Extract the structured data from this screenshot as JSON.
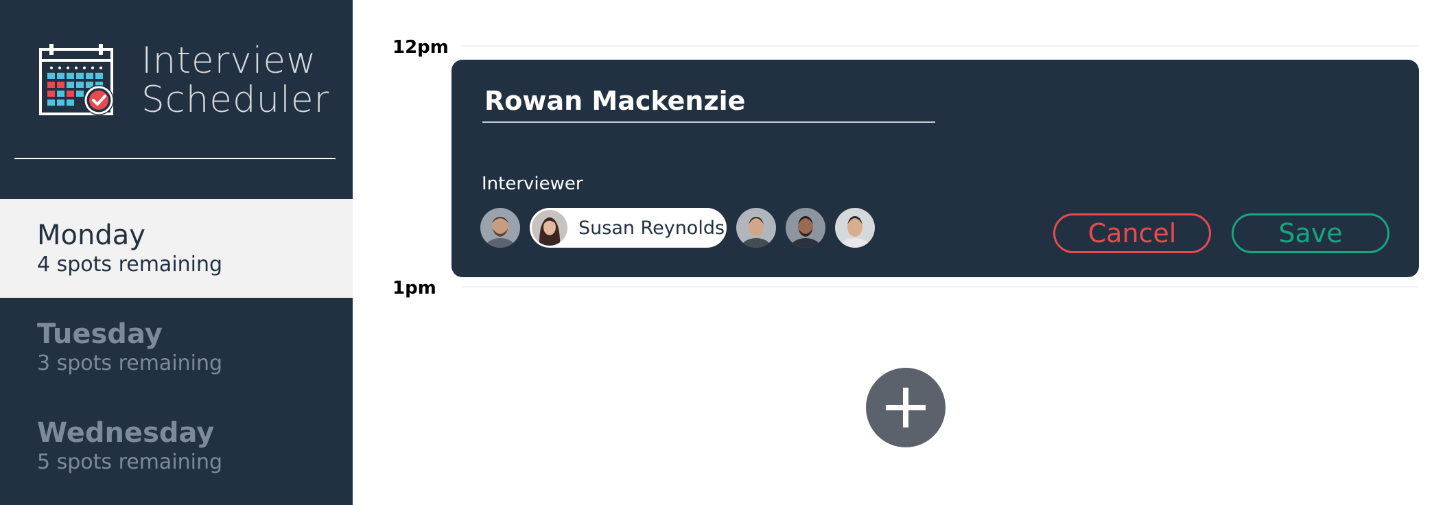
{
  "app": {
    "title_line1": "Interview",
    "title_line2": "Scheduler",
    "logo_icon": "calendar-check-icon"
  },
  "sidebar": {
    "days": [
      {
        "name": "Monday",
        "spots": "4 spots remaining",
        "active": true
      },
      {
        "name": "Tuesday",
        "spots": "3 spots remaining",
        "active": false
      },
      {
        "name": "Wednesday",
        "spots": "5 spots remaining",
        "active": false
      }
    ]
  },
  "schedule": {
    "time_slots": [
      "12pm",
      "1pm"
    ]
  },
  "appointment_form": {
    "candidate_name": "Rowan Mackenzie",
    "interviewer_label": "Interviewer",
    "interviewers": [
      {
        "icon": "avatar-man-beard",
        "selected": false
      },
      {
        "icon": "avatar-woman",
        "selected": true,
        "name": "Susan Reynolds"
      },
      {
        "icon": "avatar-man",
        "selected": false
      },
      {
        "icon": "avatar-man-dark",
        "selected": false
      },
      {
        "icon": "avatar-man-light",
        "selected": false
      }
    ],
    "cancel_label": "Cancel",
    "save_label": "Save"
  },
  "add_button": {
    "icon": "plus-icon"
  },
  "colors": {
    "sidebar_bg": "#223141",
    "active_day_bg": "#f2f2f2",
    "card_bg": "#223141",
    "cancel": "#e84a4f",
    "save": "#17a584",
    "add_button_bg": "#5b626c"
  }
}
